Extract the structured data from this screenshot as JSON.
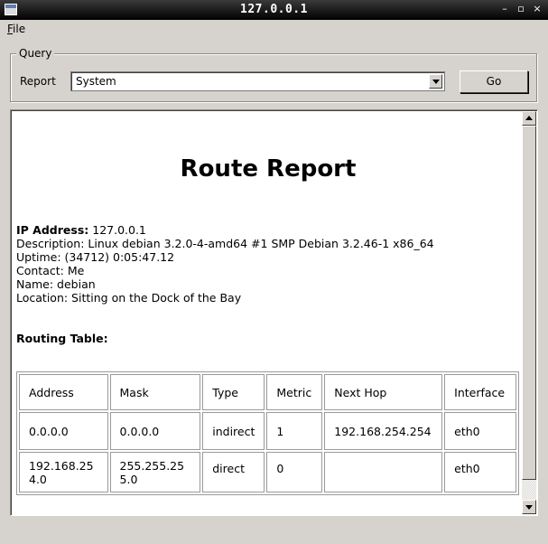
{
  "window": {
    "title": "127.0.0.1"
  },
  "menu": {
    "file_mnemonic": "F",
    "file_rest": "ile"
  },
  "query": {
    "group_title": "Query",
    "report_label": "Report",
    "report_selected": "System",
    "go_label": "Go"
  },
  "report": {
    "title": "Route Report",
    "ip_label": "IP Address:",
    "ip_value": "127.0.0.1",
    "description": "Description: Linux debian 3.2.0-4-amd64 #1 SMP Debian 3.2.46-1 x86_64",
    "uptime": "Uptime: (34712) 0:05:47.12",
    "contact": "Contact: Me",
    "name": "Name: debian",
    "location": "Location: Sitting on the Dock of the Bay",
    "routing_heading": "Routing Table:",
    "table": {
      "headers": [
        "Address",
        "Mask",
        "Type",
        "Metric",
        "Next Hop",
        "Interface"
      ],
      "rows": [
        [
          "0.0.0.0",
          "0.0.0.0",
          "indirect",
          "1",
          "192.168.254.254",
          "eth0"
        ],
        [
          "192.168.254.0",
          "255.255.255.0",
          "direct",
          "0",
          "",
          "eth0"
        ]
      ]
    }
  }
}
